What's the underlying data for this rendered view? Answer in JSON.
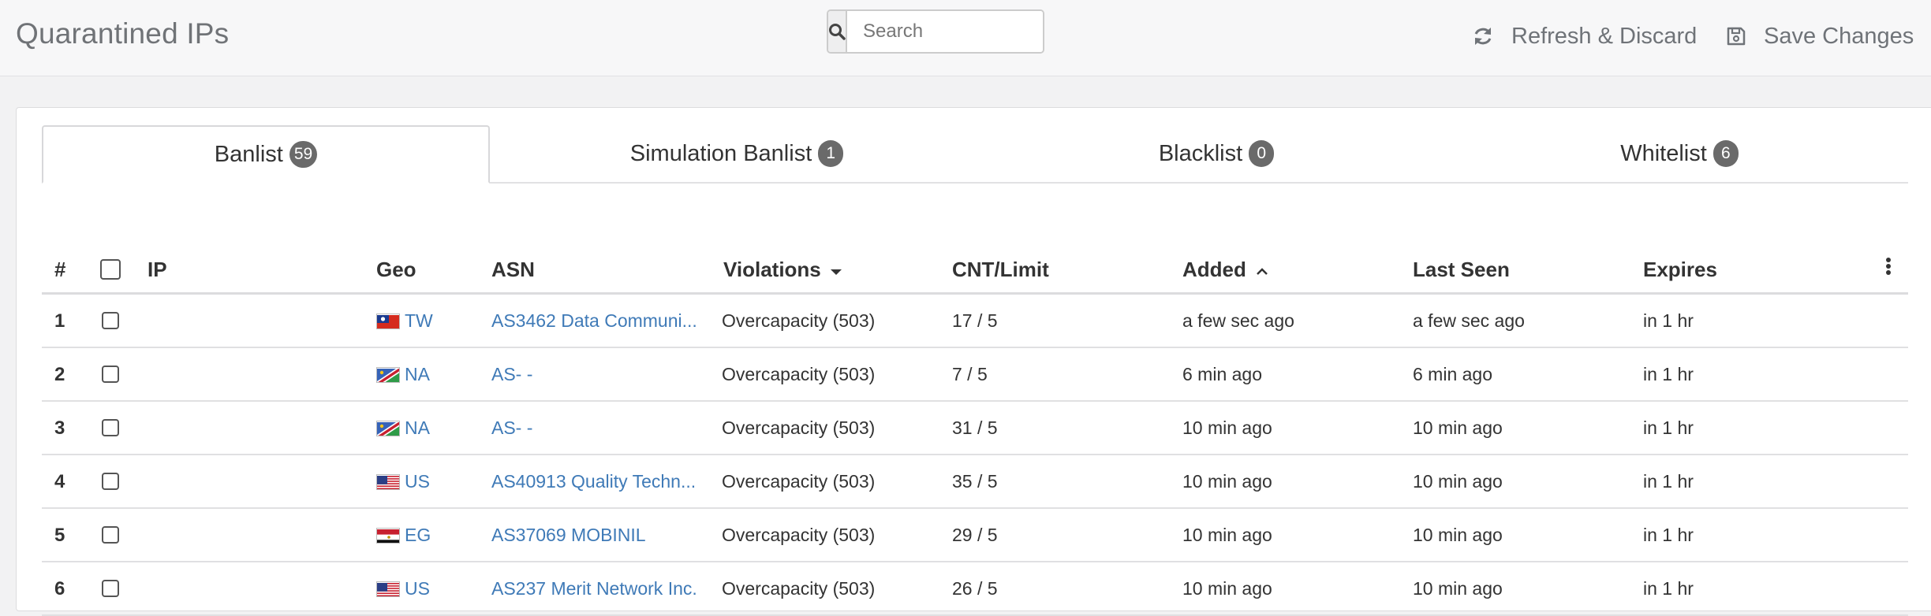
{
  "header": {
    "title": "Quarantined IPs",
    "search_placeholder": "Search",
    "refresh_label": "Refresh & Discard",
    "save_label": "Save Changes"
  },
  "tabs": [
    {
      "label": "Banlist",
      "count": "59"
    },
    {
      "label": "Simulation Banlist",
      "count": "1"
    },
    {
      "label": "Blacklist",
      "count": "0"
    },
    {
      "label": "Whitelist",
      "count": "6"
    }
  ],
  "columns": {
    "num": "#",
    "ip": "IP",
    "geo": "Geo",
    "asn": "ASN",
    "violations": "Violations",
    "cnt_limit": "CNT/Limit",
    "added": "Added",
    "last_seen": "Last Seen",
    "expires": "Expires"
  },
  "rows": [
    {
      "num": "1",
      "ip": "",
      "country": "TW",
      "flag": "tw-flag",
      "asn": "AS3462 Data Communi...",
      "violations": "Overcapacity (503)",
      "cnt": "17 / 5",
      "added": "a few sec ago",
      "last_seen": "a few sec ago",
      "expires": "in 1 hr"
    },
    {
      "num": "2",
      "ip": "",
      "country": "NA",
      "flag": "na-flag",
      "asn": "AS- -",
      "violations": "Overcapacity (503)",
      "cnt": "7 / 5",
      "added": "6 min ago",
      "last_seen": "6 min ago",
      "expires": "in 1 hr"
    },
    {
      "num": "3",
      "ip": "",
      "country": "NA",
      "flag": "na-flag",
      "asn": "AS- -",
      "violations": "Overcapacity (503)",
      "cnt": "31 / 5",
      "added": "10 min ago",
      "last_seen": "10 min ago",
      "expires": "in 1 hr"
    },
    {
      "num": "4",
      "ip": "",
      "country": "US",
      "flag": "us-flag",
      "asn": "AS40913 Quality Techn...",
      "violations": "Overcapacity (503)",
      "cnt": "35 / 5",
      "added": "10 min ago",
      "last_seen": "10 min ago",
      "expires": "in 1 hr"
    },
    {
      "num": "5",
      "ip": "",
      "country": "EG",
      "flag": "eg-flag",
      "asn": "AS37069 MOBINIL",
      "violations": "Overcapacity (503)",
      "cnt": "29 / 5",
      "added": "10 min ago",
      "last_seen": "10 min ago",
      "expires": "in 1 hr"
    },
    {
      "num": "6",
      "ip": "",
      "country": "US",
      "flag": "us-flag",
      "asn": "AS237 Merit Network Inc.",
      "violations": "Overcapacity (503)",
      "cnt": "26 / 5",
      "added": "10 min ago",
      "last_seen": "10 min ago",
      "expires": "in 1 hr"
    }
  ],
  "colors": {
    "link": "#3f7ab7",
    "badge": "#6a6a6a",
    "header_text": "#707377"
  },
  "icons": {
    "search": "search-icon",
    "refresh": "refresh-icon",
    "save": "floppy-disk-icon",
    "sort_desc": "caret-down-icon",
    "sort_asc": "chevron-up-icon",
    "more": "kebab-menu-icon"
  }
}
